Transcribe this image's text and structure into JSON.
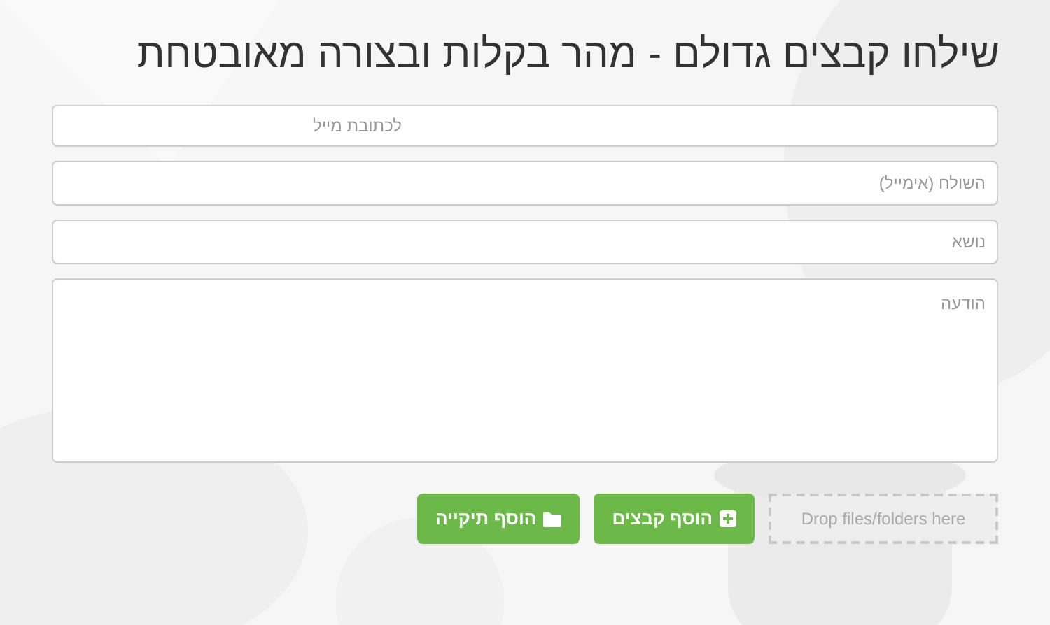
{
  "title": "שילחו קבצים גדולם - מהר בקלות ובצורה מאובטחת",
  "fields": [
    {
      "kind": "input",
      "placeholder": "לכתובת מייל"
    },
    {
      "kind": "input",
      "placeholder": "השולח (אימייל)"
    },
    {
      "kind": "input",
      "placeholder": "נושא"
    },
    {
      "kind": "textarea",
      "placeholder": "הודעה"
    }
  ],
  "buttons": [
    {
      "kind": "files",
      "label": "הוסף קבצים"
    },
    {
      "kind": "folder",
      "label": "הוסף תיקייה"
    }
  ],
  "drop_zone": {
    "label": "Drop files/folders here"
  }
}
